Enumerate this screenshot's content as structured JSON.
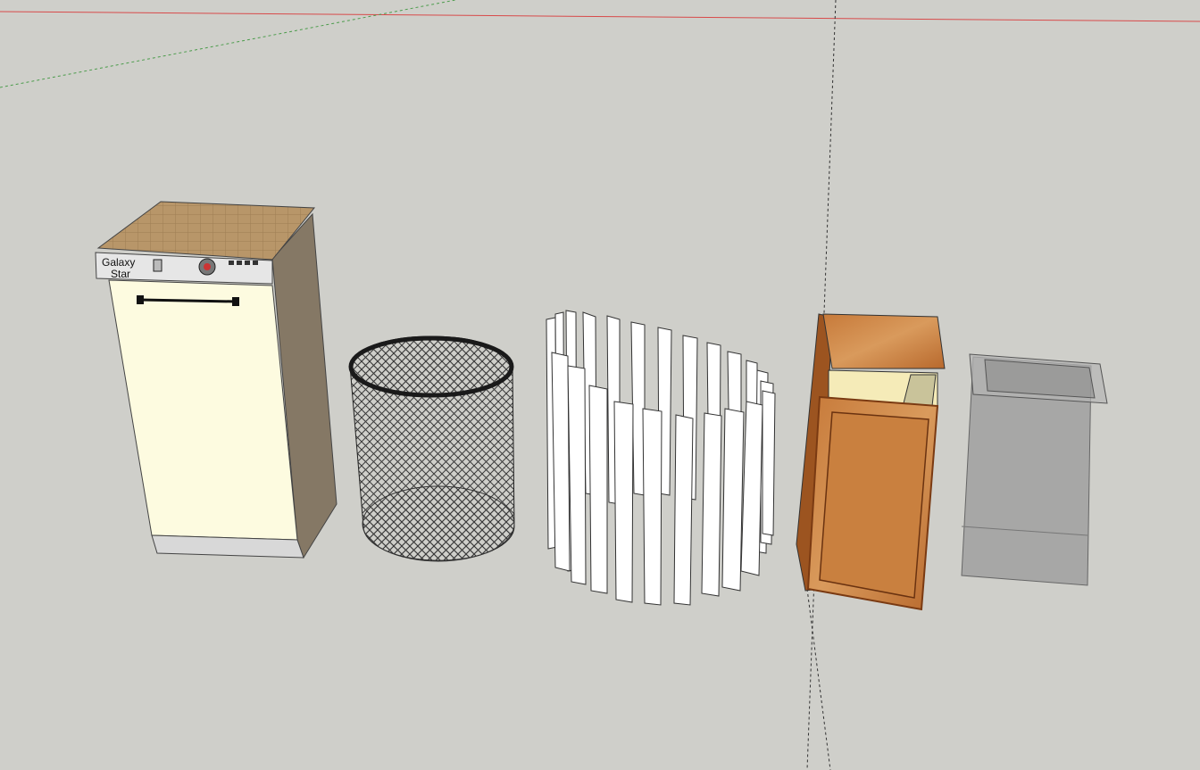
{
  "viewport": {
    "background": "#cfcfca",
    "axis_colors": {
      "red_axis": "#d84a4a",
      "green_axis": "#4c9c4c",
      "blue_axis": "#4a4a9a"
    }
  },
  "models": [
    {
      "id": "dishwasher",
      "brand_line1": "Galaxy",
      "brand_line2": "Star",
      "colors": {
        "front": "#fdfbe0",
        "side": "#857865",
        "top": "#b89669",
        "panel": "#e6e6e6"
      }
    },
    {
      "id": "mesh-basket",
      "colors": {
        "mesh": "#3a3a3a",
        "rim": "#1a1a1a"
      }
    },
    {
      "id": "slat-bin",
      "colors": {
        "slat": "#ffffff",
        "edge": "#333333"
      }
    },
    {
      "id": "wooden-cabinet-bin",
      "colors": {
        "wood": "#b86a2c",
        "lid": "#c9793a",
        "liner": "#f5ebb8"
      }
    },
    {
      "id": "translucent-bin",
      "colors": {
        "glass": "#9a9a9a",
        "edge": "#666666"
      }
    }
  ]
}
